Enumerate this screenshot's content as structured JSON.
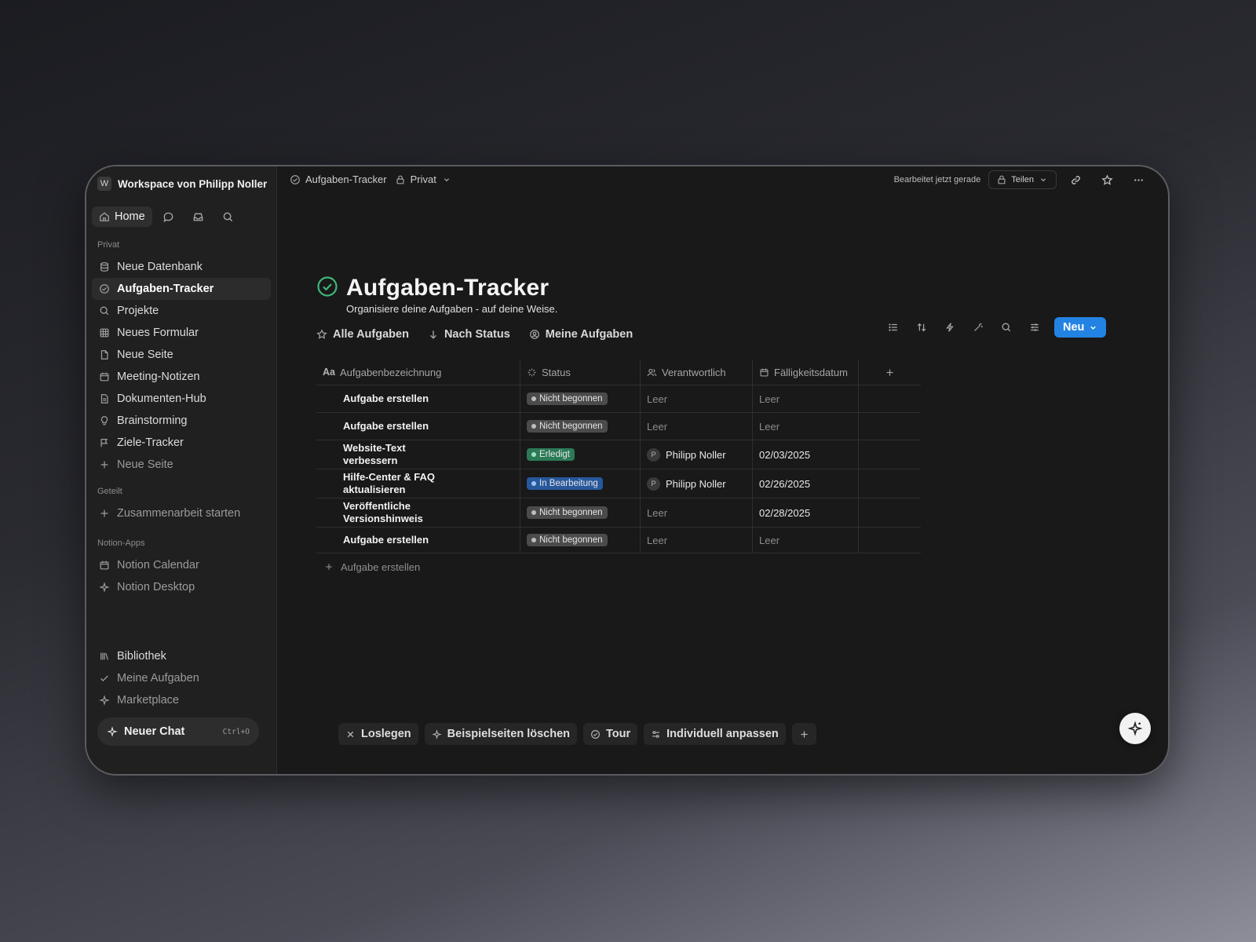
{
  "sidebar": {
    "workspace_badge": "W",
    "workspace_name": "Workspace von Philipp Noller",
    "home_label": "Home",
    "section_private": "Privat",
    "private_items": [
      {
        "label": "Neue Datenbank",
        "icon": "database-icon"
      },
      {
        "label": "Aufgaben-Tracker",
        "icon": "check-circle-icon",
        "active": true
      },
      {
        "label": "Projekte",
        "icon": "search-icon"
      },
      {
        "label": "Neues Formular",
        "icon": "table-icon"
      },
      {
        "label": "Neue Seite",
        "icon": "page-icon"
      },
      {
        "label": "Meeting-Notizen",
        "icon": "calendar-icon"
      },
      {
        "label": "Dokumenten-Hub",
        "icon": "document-icon"
      },
      {
        "label": "Brainstorming",
        "icon": "lightbulb-icon"
      },
      {
        "label": "Ziele-Tracker",
        "icon": "flag-icon"
      },
      {
        "label": "Neue Seite",
        "icon": "plus-icon"
      }
    ],
    "section_shared": "Geteilt",
    "shared_item": "Zusammenarbeit starten",
    "section_apps": "Notion-Apps",
    "app_items": [
      "Notion Calendar",
      "Notion Desktop"
    ],
    "bottom_items": [
      "Bibliothek",
      "Meine Aufgaben",
      "Marketplace"
    ],
    "chat_label": "Neuer Chat",
    "chat_shortcut": "Ctrl+O"
  },
  "topbar": {
    "page": "Aufgaben-Tracker",
    "privacy": "Privat",
    "edited": "Bearbeitet jetzt gerade",
    "share": "Teilen"
  },
  "page": {
    "title": "Aufgaben-Tracker",
    "subtitle": "Organisiere deine Aufgaben - auf deine Weise.",
    "views": [
      "Alle Aufgaben",
      "Nach Status",
      "Meine Aufgaben"
    ],
    "new_button": "Neu"
  },
  "table": {
    "columns": [
      "Aufgabenbezeichnung",
      "Status",
      "Verantwortlich",
      "Fälligkeitsdatum"
    ],
    "col1_prefix": "Aa",
    "rows": [
      {
        "name": "Aufgabe erstellen",
        "status": "Nicht begonnen",
        "owner": "Leer",
        "due": "Leer"
      },
      {
        "name": "Aufgabe erstellen",
        "status": "Nicht begonnen",
        "owner": "Leer",
        "due": "Leer"
      },
      {
        "name": "Website-Text verbessern",
        "status": "Erledigt",
        "owner": "Philipp Noller",
        "owner_initial": "P",
        "due": "02/03/2025"
      },
      {
        "name": "Hilfe-Center & FAQ aktualisieren",
        "status": "In Bearbeitung",
        "owner": "Philipp Noller",
        "owner_initial": "P",
        "due": "02/26/2025"
      },
      {
        "name": "Veröffentliche Versionshinweis",
        "status": "Nicht begonnen",
        "owner": "Leer",
        "due": "02/28/2025"
      },
      {
        "name": "Aufgabe erstellen",
        "status": "Nicht begonnen",
        "owner": "Leer",
        "due": "Leer"
      }
    ],
    "add_row": "Aufgabe erstellen"
  },
  "status_colors": {
    "Nicht begonnen": {
      "bg": "#4b4b4b",
      "dot": "#bdbdbd"
    },
    "Erledigt": {
      "bg": "#2b7a55",
      "dot": "#9fe0bf"
    },
    "In Bearbeitung": {
      "bg": "#28589c",
      "dot": "#9cc3f5"
    }
  },
  "bottom_bar": [
    "Loslegen",
    "Beispielseiten löschen",
    "Tour",
    "Individuell anpassen"
  ],
  "accent_color": "#2383e2"
}
